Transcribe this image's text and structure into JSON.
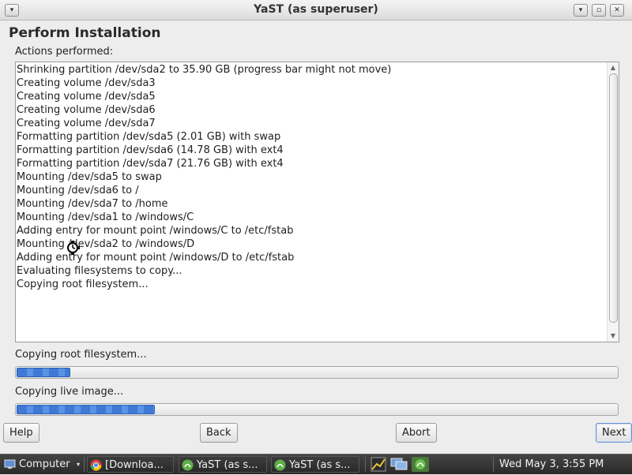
{
  "window": {
    "title": "YaST (as superuser)",
    "menu_glyph": "▾",
    "minimize_glyph": "▾",
    "maximize_glyph": "▫",
    "close_glyph": "✕"
  },
  "page": {
    "heading": "Perform Installation",
    "actions_label": "Actions performed:",
    "log_lines": [
      "Shrinking partition /dev/sda2 to 35.90 GB (progress bar might not move)",
      "Creating volume /dev/sda3",
      "Creating volume /dev/sda5",
      "Creating volume /dev/sda6",
      "Creating volume /dev/sda7",
      "Formatting partition /dev/sda5 (2.01 GB) with swap",
      "Formatting partition /dev/sda6 (14.78 GB) with ext4",
      "Formatting partition /dev/sda7 (21.76 GB) with ext4",
      "Mounting /dev/sda5 to swap",
      "Mounting /dev/sda6 to /",
      "Mounting /dev/sda7 to /home",
      "Mounting /dev/sda1 to /windows/C",
      "Adding entry for mount point /windows/C to /etc/fstab",
      "Mounting /dev/sda2 to /windows/D",
      "Adding entry for mount point /windows/D to /etc/fstab",
      "Evaluating filesystems to copy...",
      "Copying root filesystem..."
    ],
    "progress1": {
      "label": "Copying root filesystem...",
      "fraction": 0.09
    },
    "progress2": {
      "label": "Copying live image...",
      "fraction": 0.23
    }
  },
  "buttons": {
    "help": "Help",
    "back": "Back",
    "abort": "Abort",
    "next": "Next"
  },
  "taskbar": {
    "start_label": "Computer",
    "tasks": [
      {
        "label": "[Downloa...",
        "icon": "chrome-icon"
      },
      {
        "label": "YaST (as s...",
        "icon": "yast-icon"
      },
      {
        "label": "YaST (as s...",
        "icon": "yast-icon"
      }
    ],
    "tray_icons": [
      "network-monitor-icon",
      "display-icon",
      "yast-tray-icon"
    ],
    "clock": "Wed May  3,  3:55 PM"
  },
  "colors": {
    "progress_fill": "#3f79d6",
    "taskbar_bg": "#333333"
  }
}
